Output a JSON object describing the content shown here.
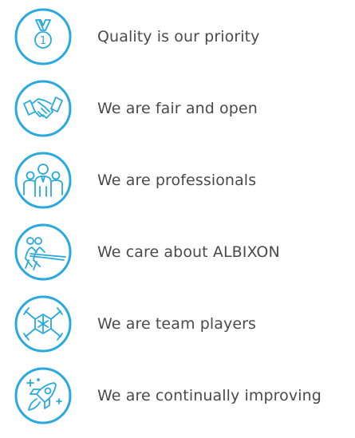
{
  "accent_color": "#29a9df",
  "text_color": "#4a4a4a",
  "values": [
    {
      "icon": "medal-icon",
      "label": "Quality is our priority",
      "medal_number": "1"
    },
    {
      "icon": "handshake-icon",
      "label": "We are fair and open"
    },
    {
      "icon": "professionals-icon",
      "label": "We are professionals"
    },
    {
      "icon": "tug-of-war-icon",
      "label": "We care about ALBIXON"
    },
    {
      "icon": "team-hands-icon",
      "label": "We are team players"
    },
    {
      "icon": "rocket-icon",
      "label": "We are continually improving"
    }
  ]
}
